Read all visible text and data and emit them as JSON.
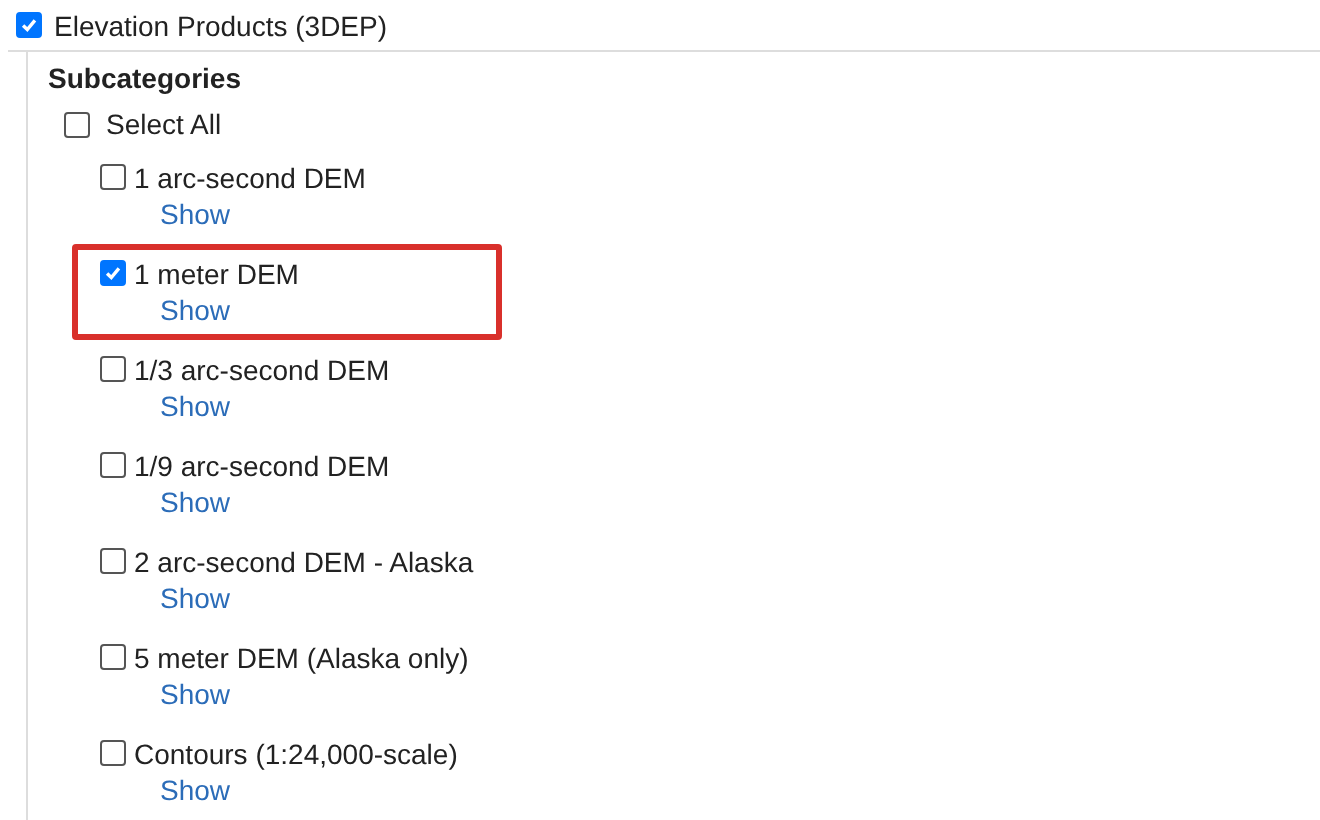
{
  "category": {
    "label": "Elevation Products (3DEP)",
    "checked": true
  },
  "subcategories": {
    "heading": "Subcategories",
    "select_all": {
      "label": "Select All",
      "checked": false
    },
    "items": [
      {
        "label": "1 arc-second DEM",
        "checked": false,
        "highlighted": false,
        "link": "Show"
      },
      {
        "label": "1 meter DEM",
        "checked": true,
        "highlighted": true,
        "link": "Show"
      },
      {
        "label": "1/3 arc-second DEM",
        "checked": false,
        "highlighted": false,
        "link": "Show"
      },
      {
        "label": "1/9 arc-second DEM",
        "checked": false,
        "highlighted": false,
        "link": "Show"
      },
      {
        "label": "2 arc-second DEM - Alaska",
        "checked": false,
        "highlighted": false,
        "link": "Show"
      },
      {
        "label": "5 meter DEM (Alaska only)",
        "checked": false,
        "highlighted": false,
        "link": "Show"
      },
      {
        "label": "Contours (1:24,000-scale)",
        "checked": false,
        "highlighted": false,
        "link": "Show"
      }
    ]
  }
}
